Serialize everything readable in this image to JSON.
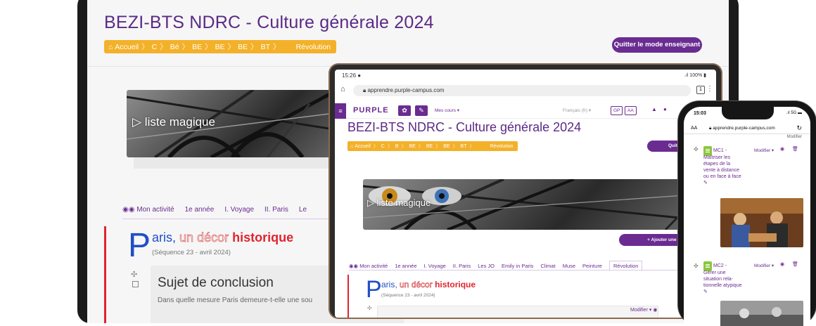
{
  "laptop": {
    "course_title": "BEZI-BTS NDRC - Culture générale 2024",
    "breadcrumb": [
      "Accueil",
      "C",
      "Bé",
      "BE",
      "BE",
      "BE",
      "BT",
      "Révolution"
    ],
    "quit_button": "Quitter le mode enseignant",
    "banner_label": "▷ liste magique",
    "tabs": [
      "Mon activité",
      "1e année",
      "I. Voyage",
      "II. Paris",
      "Le"
    ],
    "sequence": {
      "letter": "P",
      "title_1": "aris,",
      "title_2": "un décor",
      "title_3": "historique",
      "subtitle": "(Séquence 23 - avril 2024)"
    },
    "card": {
      "title": "Sujet de conclusion",
      "text": "Dans quelle mesure Paris demeure-t-elle une sou"
    }
  },
  "tablet": {
    "status_time": "15:26",
    "status_right": "100%",
    "url": "apprendre.purple-campus.com",
    "tab_count": "1",
    "logo": "PURPLE",
    "my_courses": "Mes cours ▾",
    "language": "Français (fr) ▾",
    "chips": [
      "GP",
      "AA"
    ],
    "course_title": "BEZI-BTS NDRC - Culture générale 2024",
    "breadcrumb": [
      "Accueil",
      "C",
      "B",
      "BE",
      "BE",
      "BE",
      "BT",
      "Révolution"
    ],
    "quit_button": "Quitter le mo",
    "banner_label": "▷ liste magique",
    "add_button": "+ Ajouter une activité ou r",
    "tabs": [
      "Mon activité",
      "1e année",
      "I. Voyage",
      "II. Paris",
      "Les JO",
      "Emily in Paris",
      "Climat",
      "Muse",
      "Peinture",
      "Révolution"
    ],
    "sequence": {
      "letter": "P",
      "title_1": "aris,",
      "title_2": "un décor",
      "title_3": "historique",
      "subtitle": "(Séquence 23 - avril 2024)"
    },
    "modify": "Modifier ▾"
  },
  "phone": {
    "time": "15:03",
    "signal": "5G",
    "aa": "AA",
    "url": "apprendre.purple-campus.com",
    "top_modify": "Modifier",
    "activities": [
      {
        "code": "MC1 -",
        "body": "Maîtriser les étapes de la vente à distance ou en face à face ✎",
        "modify": "Modifier ▾"
      },
      {
        "code": "MC2 -",
        "body": "Gérer une situation rela-tionnelle atypique ✎",
        "modify": "Modifier ▾"
      }
    ]
  },
  "colors": {
    "purple": "#6a2c91",
    "title_purple": "#5b2a86",
    "breadcrumb_orange": "#f3b12a",
    "red": "#e0242f",
    "blue": "#1f4fc7",
    "green": "#8cc63f"
  }
}
